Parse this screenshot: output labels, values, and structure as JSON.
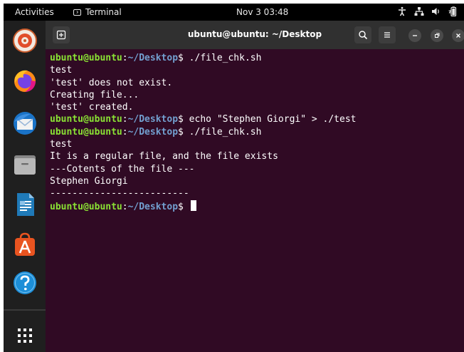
{
  "topbar": {
    "activities": "Activities",
    "app_name": "Terminal",
    "clock": "Nov 3  03:48"
  },
  "window": {
    "title": "ubuntu@ubuntu: ~/Desktop"
  },
  "terminal": {
    "prompt_user": "ubuntu@ubuntu",
    "prompt_path": "~/Desktop",
    "lines": [
      {
        "type": "prompt",
        "cmd": " ./file_chk.sh"
      },
      {
        "type": "output",
        "text": "test"
      },
      {
        "type": "output",
        "text": "'test' does not exist."
      },
      {
        "type": "output",
        "text": "Creating file..."
      },
      {
        "type": "output",
        "text": "'test' created."
      },
      {
        "type": "prompt",
        "cmd": " echo \"Stephen Giorgi\" > ./test"
      },
      {
        "type": "prompt",
        "cmd": " ./file_chk.sh"
      },
      {
        "type": "output",
        "text": "test"
      },
      {
        "type": "output",
        "text": "It is a regular file, and the file exists"
      },
      {
        "type": "output",
        "text": "---Cotents of the file ---"
      },
      {
        "type": "output",
        "text": "Stephen Giorgi"
      },
      {
        "type": "output",
        "text": "-------------------------"
      },
      {
        "type": "prompt",
        "cmd": " ",
        "cursor": true
      }
    ]
  },
  "dock": {
    "items": [
      "rhythmbox-icon",
      "firefox-icon",
      "thunderbird-icon",
      "files-icon",
      "writer-icon",
      "software-icon",
      "help-icon"
    ]
  },
  "colors": {
    "terminal_bg": "#300a24",
    "prompt_user": "#8ae234",
    "prompt_path": "#729fcf",
    "topbar_bg": "#000000",
    "dock_bg": "#1f1f1f"
  }
}
